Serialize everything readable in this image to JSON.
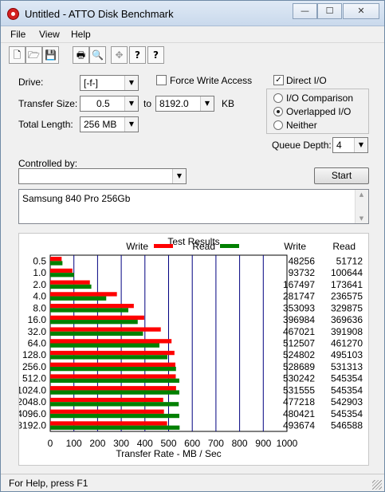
{
  "window": {
    "title": "Untitled - ATTO Disk Benchmark",
    "minimize_glyph": "—",
    "maximize_glyph": "☐",
    "close_glyph": "✕"
  },
  "menu": [
    "File",
    "View",
    "Help"
  ],
  "toolbar": {
    "icons": [
      "new-file-icon",
      "open-folder-icon",
      "save-icon",
      "print-icon",
      "print-preview-icon",
      "move-icon",
      "help-icon",
      "context-help-icon"
    ],
    "glyphs": [
      "🗋",
      "🗁",
      "💾",
      "🖶",
      "🔍",
      "✥",
      "?",
      "?"
    ]
  },
  "settings": {
    "drive_label": "Drive:",
    "drive_value": "[-f-]",
    "force_write_access_label": "Force Write Access",
    "force_write_access_checked": false,
    "direct_io_label": "Direct I/O",
    "direct_io_checked": true,
    "transfer_size_label": "Transfer Size:",
    "transfer_size_from": "0.5",
    "to_label": "to",
    "transfer_size_to": "8192.0",
    "kb_label": "KB",
    "total_length_label": "Total Length:",
    "total_length_value": "256 MB",
    "io_options": [
      {
        "label": "I/O Comparison",
        "selected": false
      },
      {
        "label": "Overlapped I/O",
        "selected": true
      },
      {
        "label": "Neither",
        "selected": false
      }
    ],
    "queue_depth_label": "Queue Depth:",
    "queue_depth_value": "4",
    "controlled_by_label": "Controlled by:",
    "controlled_by_value": "",
    "start_label": "Start",
    "description": "Samsung 840 Pro 256Gb"
  },
  "results": {
    "title": "Test Results",
    "legend_write": "Write",
    "legend_read": "Read",
    "col_write": "Write",
    "col_read": "Read",
    "rows": [
      {
        "size": "0.5",
        "write": "48256",
        "read": "51712"
      },
      {
        "size": "1.0",
        "write": "93732",
        "read": "100644"
      },
      {
        "size": "2.0",
        "write": "167497",
        "read": "173641"
      },
      {
        "size": "4.0",
        "write": "281747",
        "read": "236575"
      },
      {
        "size": "8.0",
        "write": "353093",
        "read": "329875"
      },
      {
        "size": "16.0",
        "write": "396984",
        "read": "369636"
      },
      {
        "size": "32.0",
        "write": "467021",
        "read": "391908"
      },
      {
        "size": "64.0",
        "write": "512507",
        "read": "461270"
      },
      {
        "size": "128.0",
        "write": "524802",
        "read": "495103"
      },
      {
        "size": "256.0",
        "write": "528689",
        "read": "531313"
      },
      {
        "size": "512.0",
        "write": "530242",
        "read": "545354"
      },
      {
        "size": "1024.0",
        "write": "531555",
        "read": "545354"
      },
      {
        "size": "2048.0",
        "write": "477218",
        "read": "542903"
      },
      {
        "size": "4096.0",
        "write": "480421",
        "read": "545354"
      },
      {
        "size": "8192.0",
        "write": "493674",
        "read": "546588"
      }
    ]
  },
  "chart_data": {
    "type": "bar",
    "orientation": "horizontal",
    "categories": [
      "0.5",
      "1.0",
      "2.0",
      "4.0",
      "8.0",
      "16.0",
      "32.0",
      "64.0",
      "128.0",
      "256.0",
      "512.0",
      "1024.0",
      "2048.0",
      "4096.0",
      "8192.0"
    ],
    "series": [
      {
        "name": "Write",
        "color": "#ff0000",
        "values": [
          48.256,
          93.732,
          167.497,
          281.747,
          353.093,
          396.984,
          467.021,
          512.507,
          524.802,
          528.689,
          530.242,
          531.555,
          477.218,
          480.421,
          493.674
        ]
      },
      {
        "name": "Read",
        "color": "#008000",
        "values": [
          51.712,
          100.644,
          173.641,
          236.575,
          329.875,
          369.636,
          391.908,
          461.27,
          495.103,
          531.313,
          545.354,
          545.354,
          542.903,
          545.354,
          546.588
        ]
      }
    ],
    "xlabel": "Transfer Rate - MB / Sec",
    "xlim": [
      0,
      1000
    ],
    "xticks": [
      "0",
      "100",
      "200",
      "300",
      "400",
      "500",
      "600",
      "700",
      "800",
      "900",
      "1000"
    ],
    "grid": "vertical",
    "gridline_color": "#000080",
    "legend": "top"
  },
  "status": {
    "text": "For Help, press F1"
  }
}
